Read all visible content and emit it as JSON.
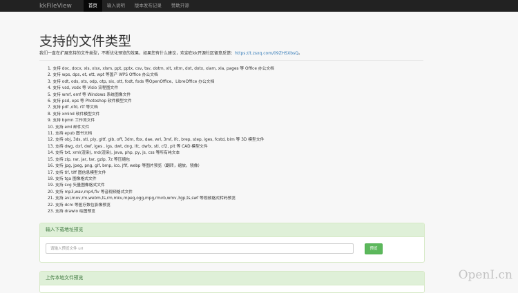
{
  "navbar": {
    "brand": "kkFileView",
    "items": [
      {
        "label": "首页",
        "active": true
      },
      {
        "label": "输入说明",
        "active": false
      },
      {
        "label": "版本发布记录",
        "active": false
      },
      {
        "label": "赞助开源",
        "active": false
      }
    ]
  },
  "page": {
    "title": "支持的文件类型",
    "intro_text": "我们一直在扩展支持的文件类型，不断优化预览的效果，如果您有什么建议，欢迎在kk开源社区留意反馈：",
    "intro_link": "https://t.zsxq.com/09ZHSXbsQ",
    "intro_end": "。"
  },
  "formats": [
    "1. 支持 doc, docx, xls, xlsx, xlsm, ppt, pptx, csv, tsv, dotm, xlt, xltm, dot, dotx, xlam, xla, pages 等 Office 办公文档",
    "2. 支持 wps, dps, et, ett, wpt 等国产 WPS Office 办公文档",
    "3. 支持 odt, ods, ots, odp, otp, six, ott, fodt, fods 等OpenOffice、LibreOffice 办公文档",
    "4. 支持 vsd, vsdx 等 Visio 流程图文件",
    "5. 支持 wmf, emf 等 Windows 系统图像文件",
    "6. 支持 psd, eps 等 Photoshop 软件模型文件",
    "7. 支持 pdf ,ofd, rtf 等文档",
    "8. 支持 xmind 软件模型文件",
    "9. 支持 bpmn 工作流文件",
    "10. 支持 eml 邮件文件",
    "11. 支持 epub 图书文档",
    "12. 支持 obj, 3ds, stl, ply, gltf, glb, off, 3dm, fbx, dae, wrl, 3mf, ifc, brep, step, iges, fcstd, bim 等 3D 模型文件",
    "13. 支持 dwg, dxf, dwf, iges , igs, dwt, dng, ifc, dwfx, stl, cf2, plt 等 CAD 模型文件",
    "14. 支持 txt, xml(渲染), md(渲染), java, php, py, js, css 等所有纯文本",
    "15. 支持 zip, rar, jar, tar, gzip, 7z 等压缩包",
    "16. 支持 jpg, jpeg, png, gif, bmp, ico, jfif, webp 等图片预览（翻转，缩放，镜像）",
    "17. 支持 tif, tiff 图信息模型文件",
    "18. 支持 tga 图像格式文件",
    "19. 支持 svg 矢量图像格式文件",
    "20. 支持 mp3,wav,mp4,flv 等音视频格式文件",
    "21. 支持 avi,mov,rm,webm,ts,rm,mkv,mpeg,ogg,mpg,rmvb,wmv,3gp,ts,swf 等视频格式转码预览",
    "22. 支持 dcm 等医疗数位影像预览",
    "23. 支持 drawio 绘图预览"
  ],
  "url_panel": {
    "heading": "输入下载地址预览",
    "placeholder": "请输入预览文件 url",
    "button": "预览"
  },
  "upload_panel": {
    "heading": "上传本地文件预览"
  },
  "watermark": "OpenI.cn",
  "colors": {
    "navbar_bg": "#222222",
    "panel_heading_bg": "#dff0d8",
    "panel_heading_text": "#3c763d",
    "button_bg": "#5cb85c",
    "link": "#337ab7"
  }
}
